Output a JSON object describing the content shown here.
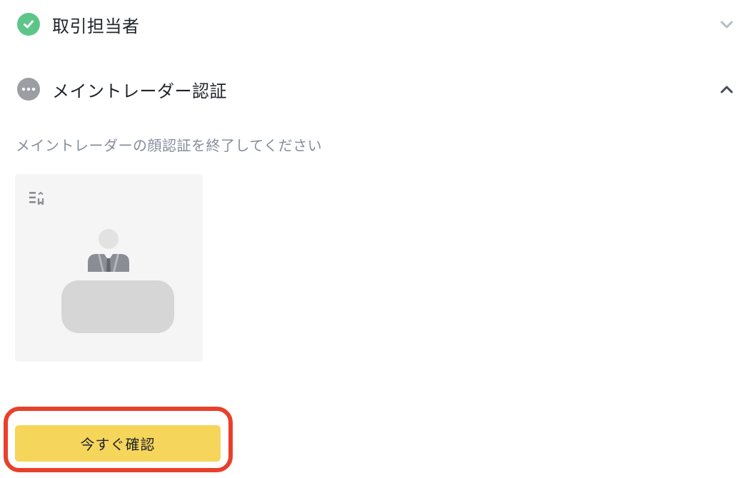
{
  "sections": [
    {
      "title": "取引担当者",
      "status_icon": "check-circle-icon",
      "status_color": "#5ec58a",
      "expanded": false,
      "chevron_icon": "chevron-down-icon"
    },
    {
      "title": "メイントレーダー認証",
      "status_icon": "more-dots-icon",
      "status_color": "#9c9ea3",
      "expanded": true,
      "chevron_icon": "chevron-up-icon"
    }
  ],
  "verification": {
    "instruction": "メイントレーダーの顔認証を終了してください",
    "illustration_icon": "person-at-desk-icon"
  },
  "actions": {
    "confirm_label": "今すぐ確認",
    "confirm_color": "#f6d55b",
    "highlight_color": "#e8402a"
  }
}
